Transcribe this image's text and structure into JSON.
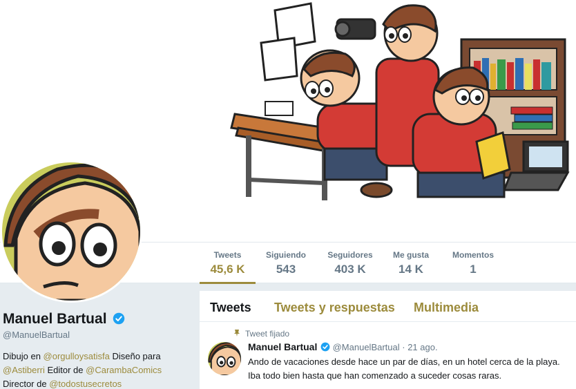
{
  "banner": {
    "description_icon": "cartoon-banner-illustration"
  },
  "stats": [
    {
      "label": "Tweets",
      "value": "45,6 K",
      "active": true
    },
    {
      "label": "Siguiendo",
      "value": "543"
    },
    {
      "label": "Seguidores",
      "value": "403 K"
    },
    {
      "label": "Me gusta",
      "value": "14 K"
    },
    {
      "label": "Momentos",
      "value": "1"
    }
  ],
  "profile": {
    "name": "Manuel Bartual",
    "handle": "@ManuelBartual",
    "bio": {
      "l1_a": "Dibujo en ",
      "l1_link": "@orgulloysatisfa",
      "l1_b": " Diseño para",
      "l2_link": "@Astiberri",
      "l2_a": " Editor de ",
      "l2_link2": "@CarambaComics",
      "l3_a": "Director de ",
      "l3_link": "@todostusecretos"
    }
  },
  "tabs": [
    {
      "label": "Tweets",
      "active": true
    },
    {
      "label": "Tweets y respuestas"
    },
    {
      "label": "Multimedia"
    }
  ],
  "tweet": {
    "pinned_label": "Tweet fijado",
    "author_name": "Manuel Bartual",
    "author_handle": "@ManuelBartual",
    "date": "· 21 ago.",
    "line1": "Ando de vacaciones desde hace un par de días, en un hotel cerca de la playa.",
    "line2": "Iba todo bien hasta que han comenzado a suceder cosas raras."
  },
  "colors": {
    "accent": "#9c8b3c",
    "verified": "#1da1f2",
    "secondary_text": "#657786"
  }
}
